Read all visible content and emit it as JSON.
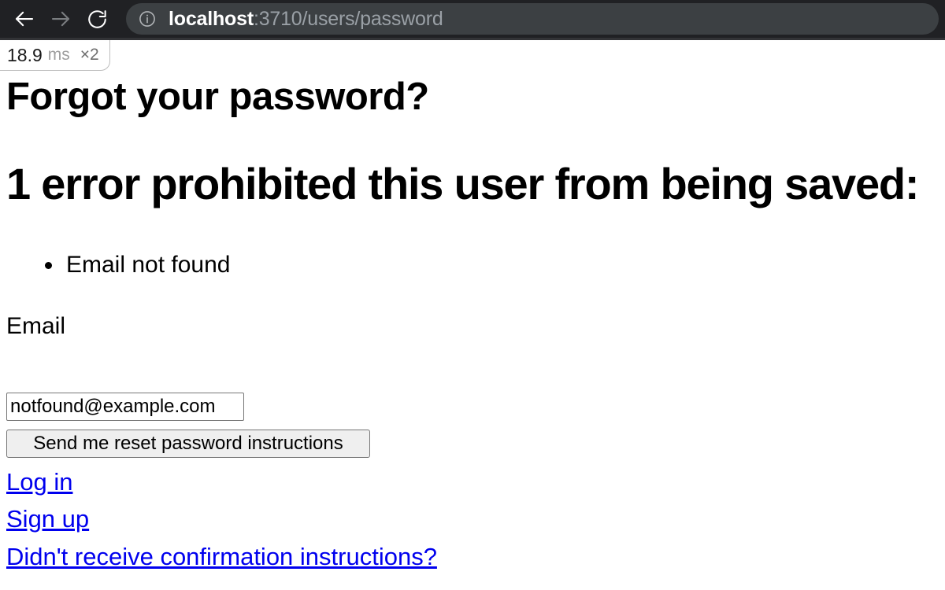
{
  "browser": {
    "back_icon": "arrow-left-icon",
    "forward_icon": "arrow-right-icon",
    "reload_icon": "reload-icon",
    "site_info_icon": "info-circle-icon",
    "url_host": "localhost",
    "url_path": ":3710/users/password",
    "url_full": "localhost:3710/users/password",
    "colors": {
      "toolbar_bg": "#202124",
      "omnibox_bg": "#3c4043",
      "host_text": "#ffffff",
      "path_text": "#9aa0a6"
    }
  },
  "miniprofiler": {
    "time": "18.9",
    "unit": "ms",
    "count": "×2"
  },
  "page": {
    "heading": "Forgot your password?",
    "error_heading": "1 error prohibited this user from being saved:",
    "errors": [
      "Email not found"
    ],
    "form": {
      "email_label": "Email",
      "email_value": "notfound@example.com",
      "email_placeholder": "",
      "submit_label": "Send me reset password instructions"
    },
    "links": [
      {
        "label": "Log in"
      },
      {
        "label": "Sign up"
      },
      {
        "label": "Didn't receive confirmation instructions?"
      }
    ],
    "colors": {
      "link": "#0000ee",
      "text": "#000000",
      "background": "#ffffff",
      "button_bg": "#efefef",
      "control_border": "#767676"
    }
  }
}
